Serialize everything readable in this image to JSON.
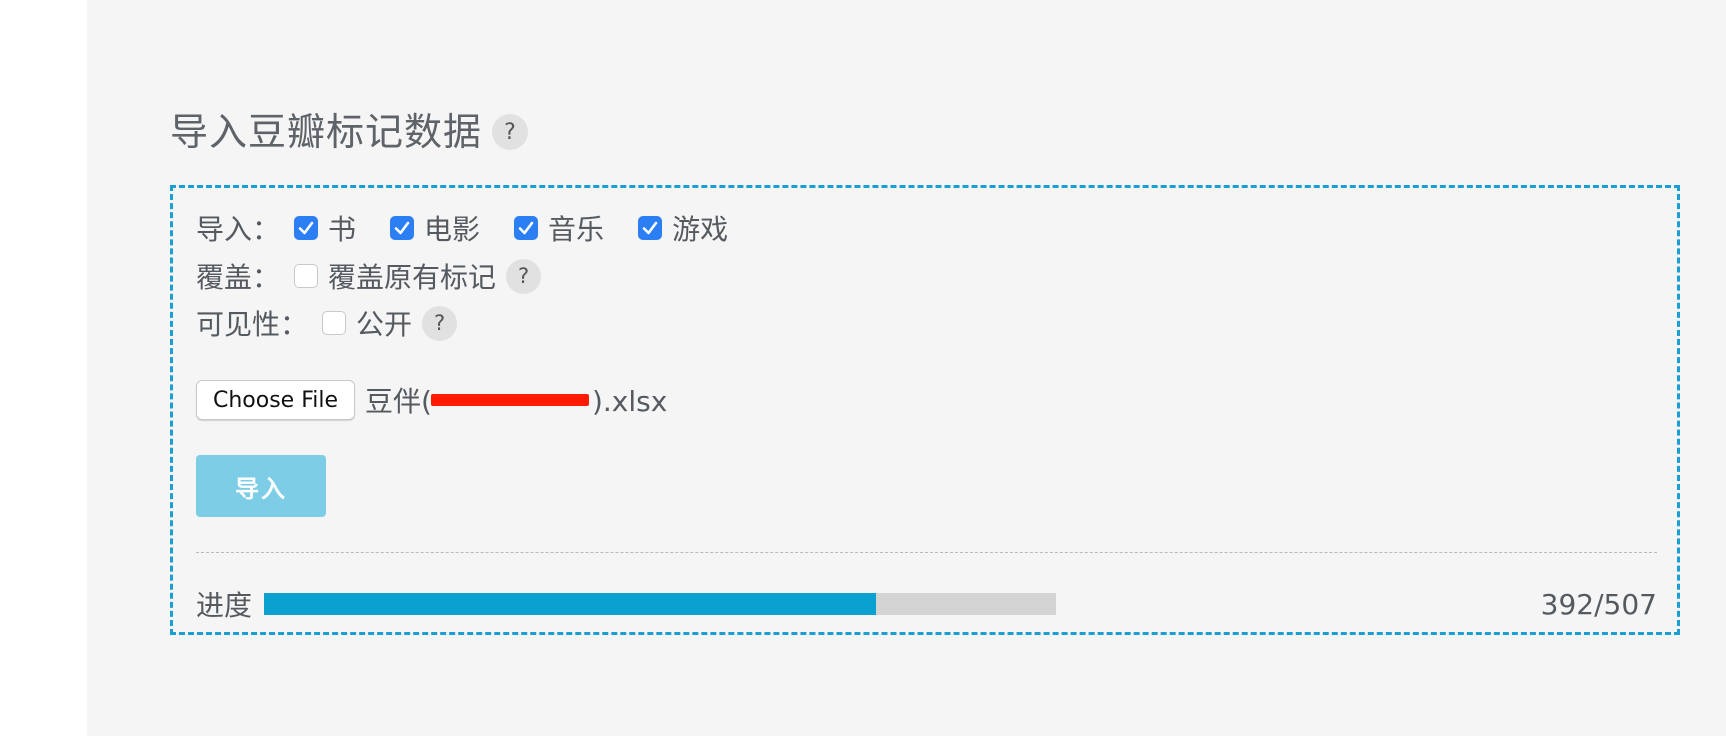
{
  "page": {
    "title": "导入豆瓣标记数据",
    "title_help": "?"
  },
  "form": {
    "import_label": "导入：",
    "categories": [
      {
        "label": "书",
        "checked": true
      },
      {
        "label": "电影",
        "checked": true
      },
      {
        "label": "音乐",
        "checked": true
      },
      {
        "label": "游戏",
        "checked": true
      }
    ],
    "overwrite_label": "覆盖：",
    "overwrite_option": "覆盖原有标记",
    "overwrite_checked": false,
    "overwrite_help": "?",
    "visibility_label": "可见性：",
    "visibility_option": "公开",
    "visibility_checked": false,
    "visibility_help": "?",
    "choose_file": "Choose File",
    "file_name_prefix": "豆伴(",
    "file_name_suffix": ").xlsx",
    "submit": "导入"
  },
  "progress": {
    "label": "进度",
    "done": 392,
    "total": 507,
    "text": "392/507"
  },
  "colors": {
    "accent": "#0aa1d0",
    "checkbox": "#2b7ff2",
    "button_disabled": "#7dcde7",
    "redaction": "#ff1a00"
  }
}
